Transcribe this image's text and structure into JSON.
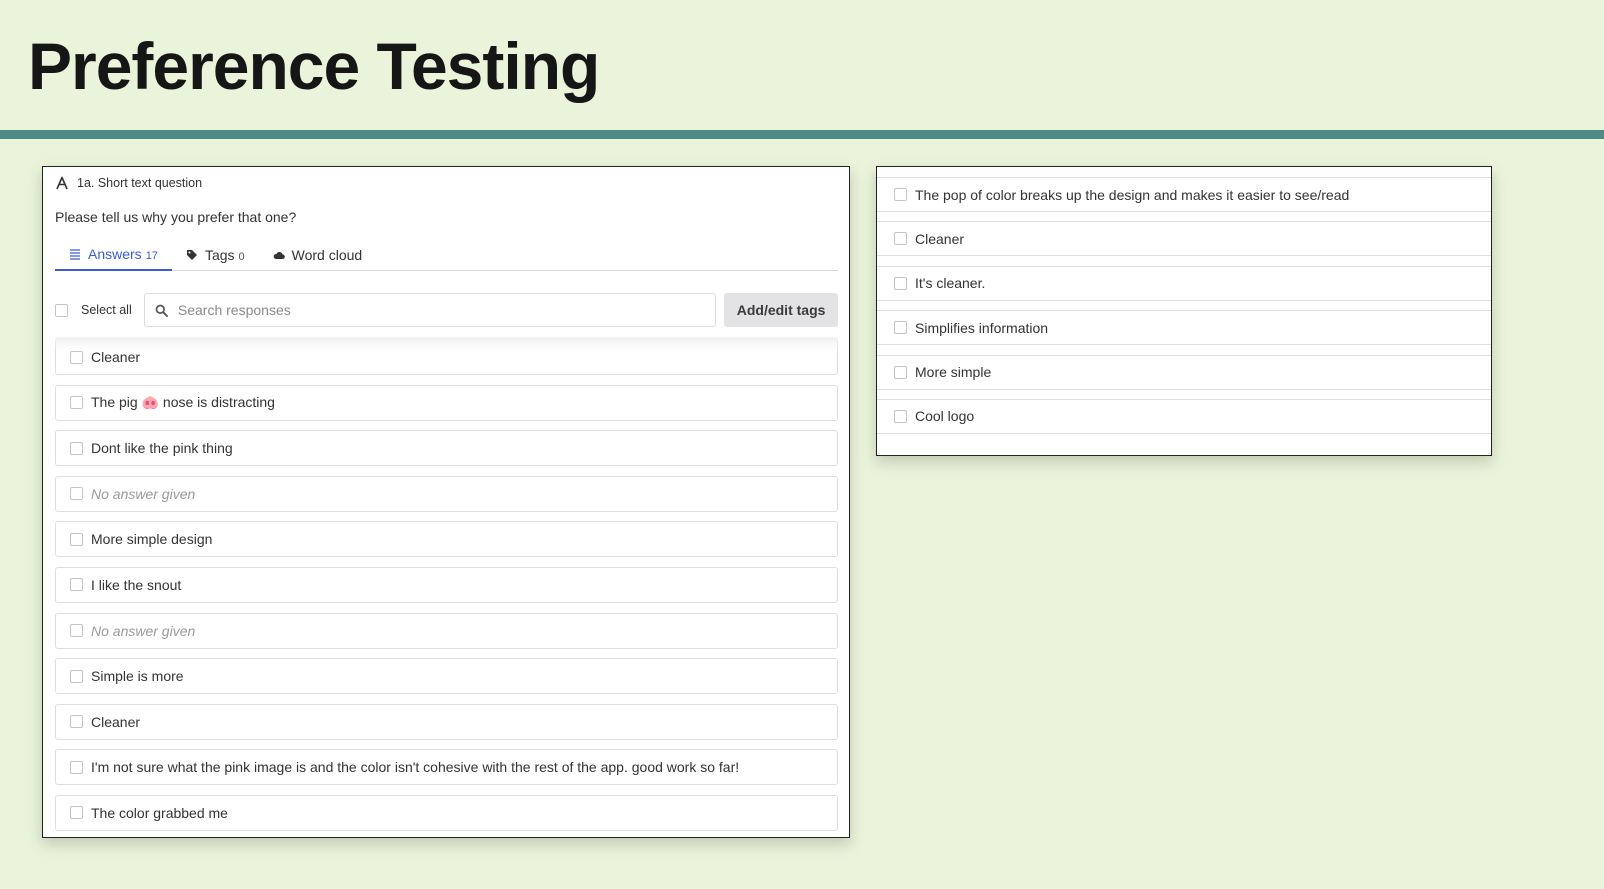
{
  "page": {
    "title": "Preference Testing"
  },
  "question": {
    "label": "1a. Short text question",
    "text": "Please tell us why you prefer that one?",
    "icon": "short-text-icon"
  },
  "tabs": [
    {
      "label": "Answers",
      "count": "17",
      "icon": "list-icon"
    },
    {
      "label": "Tags",
      "count": "0",
      "icon": "tag-icon"
    },
    {
      "label": "Word cloud",
      "icon": "cloud-icon"
    }
  ],
  "toolbar": {
    "select_all": "Select all",
    "search_placeholder": "Search responses",
    "add_tags": "Add/edit tags"
  },
  "answers_left": [
    "Cleaner",
    "The pig 🐽 nose is distracting",
    "Dont like the pink thing",
    "No answer given",
    "More simple design",
    "I like the snout",
    "No answer given",
    "Simple is more",
    "Cleaner",
    "I'm not sure what the pink image is and the color isn't cohesive with the rest of the app. good work so far!",
    "The color grabbed me"
  ],
  "answers_right": [
    "The pop of color breaks up the design and makes it easier to see/read",
    "Cleaner",
    "It's cleaner.",
    "Simplifies information",
    "More simple",
    "Cool logo"
  ],
  "colors": {
    "background": "#e9f4da",
    "rule": "#4e8b85",
    "accent": "#3a5bd6"
  }
}
